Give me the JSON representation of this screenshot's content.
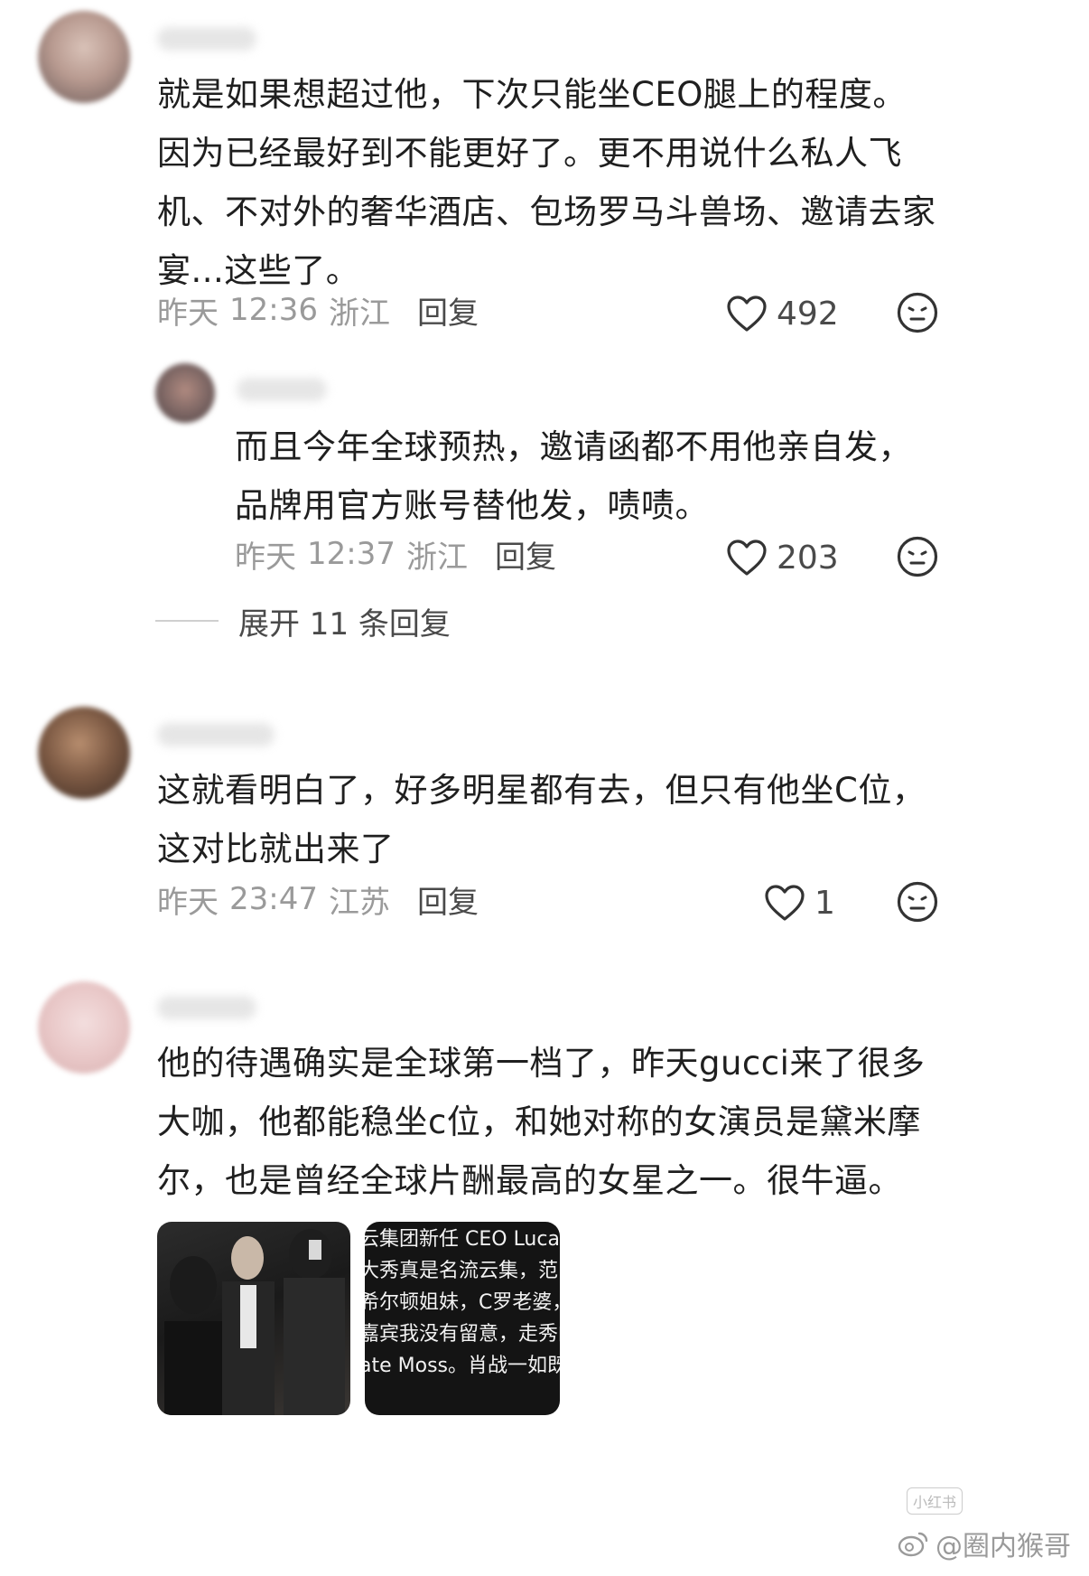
{
  "comments": [
    {
      "text": "就是如果想超过他，下次只能坐CEO腿上的程度。\n因为已经最好到不能更好了。更不用说什么私人飞\n机、不对外的奢华酒店、包场罗马斗兽场、邀请去家\n宴...这些了。",
      "date": "昨天",
      "time": "12:36",
      "location": "浙江",
      "reply_label": "回复",
      "likes": "492"
    },
    {
      "text": "而且今年全球预热，邀请函都不用他亲自发，\n品牌用官方账号替他发，啧啧。",
      "date": "昨天",
      "time": "12:37",
      "location": "浙江",
      "reply_label": "回复",
      "likes": "203"
    },
    {
      "text": "这就看明白了，好多明星都有去，但只有他坐C位，\n这对比就出来了",
      "date": "昨天",
      "time": "23:47",
      "location": "江苏",
      "reply_label": "回复",
      "likes": "1"
    },
    {
      "text": "他的待遇确实是全球第一档了，昨天gucci来了很多\n大咖，他都能稳坐c位，和她对称的女演员是黛米摩\n尔，也是曾经全球片酬最高的女星之一。很牛逼。"
    }
  ],
  "expand_label": "展开 11 条回复",
  "thumb_text_lines": [
    "云集团新任 CEO Luca",
    "大秀真是名流云集，范",
    "希尔顿姐妹，C罗老婆，",
    "嘉宾我没有留意，走秀的",
    "ate Moss。肖战一如既"
  ],
  "watermark": "@圈内猴哥",
  "small_mark": "小红书",
  "icons": {
    "like": "heart-icon",
    "dislike": "meh-face-icon"
  },
  "colors": {
    "text": "#1f1f1f",
    "meta": "#9a9a9a",
    "reply": "#4a4a4a"
  }
}
